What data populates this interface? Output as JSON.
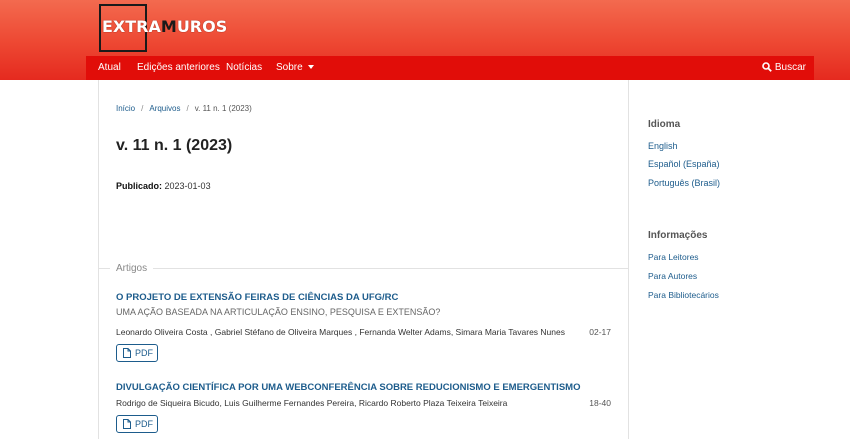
{
  "header": {
    "logo": {
      "text_part1": "EXTRA",
      "text_part2": "M",
      "text_part3": "UROS"
    },
    "nav": [
      {
        "label": "Atual"
      },
      {
        "label": "Edições anteriores"
      },
      {
        "label": "Notícias"
      },
      {
        "label": "Sobre"
      }
    ],
    "search_label": "Buscar"
  },
  "breadcrumb": {
    "home": "Início",
    "archive": "Arquivos",
    "current": "v. 11 n. 1 (2023)"
  },
  "issue": {
    "title": "v. 11 n. 1 (2023)",
    "published_label": "Publicado:",
    "published_date": "2023-01-03"
  },
  "section": {
    "title": "Artigos"
  },
  "articles": [
    {
      "title": "O PROJETO DE EXTENSÃO FEIRAS DE CIÊNCIAS DA UFG/RC",
      "subtitle": "UMA AÇÃO BASEADA NA ARTICULAÇÃO ENSINO, PESQUISA E EXTENSÃO?",
      "authors": "Leonardo Oliveira Costa , Gabriel Stéfano de Oliveira Marques , Fernanda Welter Adams, Simara Maria Tavares Nunes",
      "pages": "02-17",
      "galley": "PDF"
    },
    {
      "title": "DIVULGAÇÃO CIENTÍFICA POR UMA WEBCONFERÊNCIA SOBRE REDUCIONISMO E EMERGENTISMO",
      "authors": "Rodrigo de Siqueira Bicudo, Luis Guilherme Fernandes Pereira, Ricardo Roberto Plaza Teixeira Teixeira",
      "pages": "18-40",
      "galley": "PDF"
    }
  ],
  "sidebar": {
    "language": {
      "heading": "Idioma",
      "items": [
        "English",
        "Español (España)",
        "Português (Brasil)"
      ]
    },
    "info": {
      "heading": "Informações",
      "items": [
        "Para Leitores",
        "Para Autores",
        "Para Bibliotecários"
      ]
    }
  },
  "colors": {
    "header_top": "#f36a4f",
    "navbar": "#e10d09",
    "link": "#1d5c8c"
  }
}
